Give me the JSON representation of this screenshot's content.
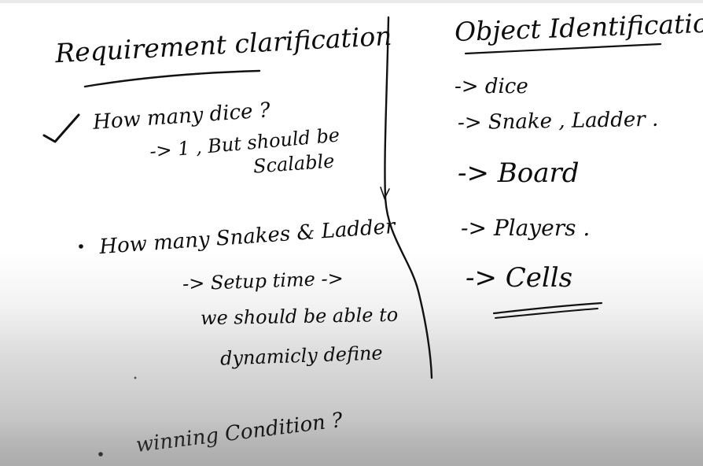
{
  "left": {
    "heading": "Requirement clarification",
    "q1": "How many dice ?",
    "q1_answer_line1": "-> 1 , But should be",
    "q1_answer_line2": "Scalable",
    "q2": "How many Snakes & Ladder",
    "q2_answer_line1": "-> Setup time ->",
    "q2_answer_line2": "we should be able to",
    "q2_answer_line3": "dynamicly define",
    "q3": "winning Condition ?"
  },
  "right": {
    "heading": "Object Identification",
    "items": [
      "-> dice",
      "-> Snake , Ladder .",
      "-> Board",
      "-> Players .",
      "-> Cells"
    ]
  }
}
